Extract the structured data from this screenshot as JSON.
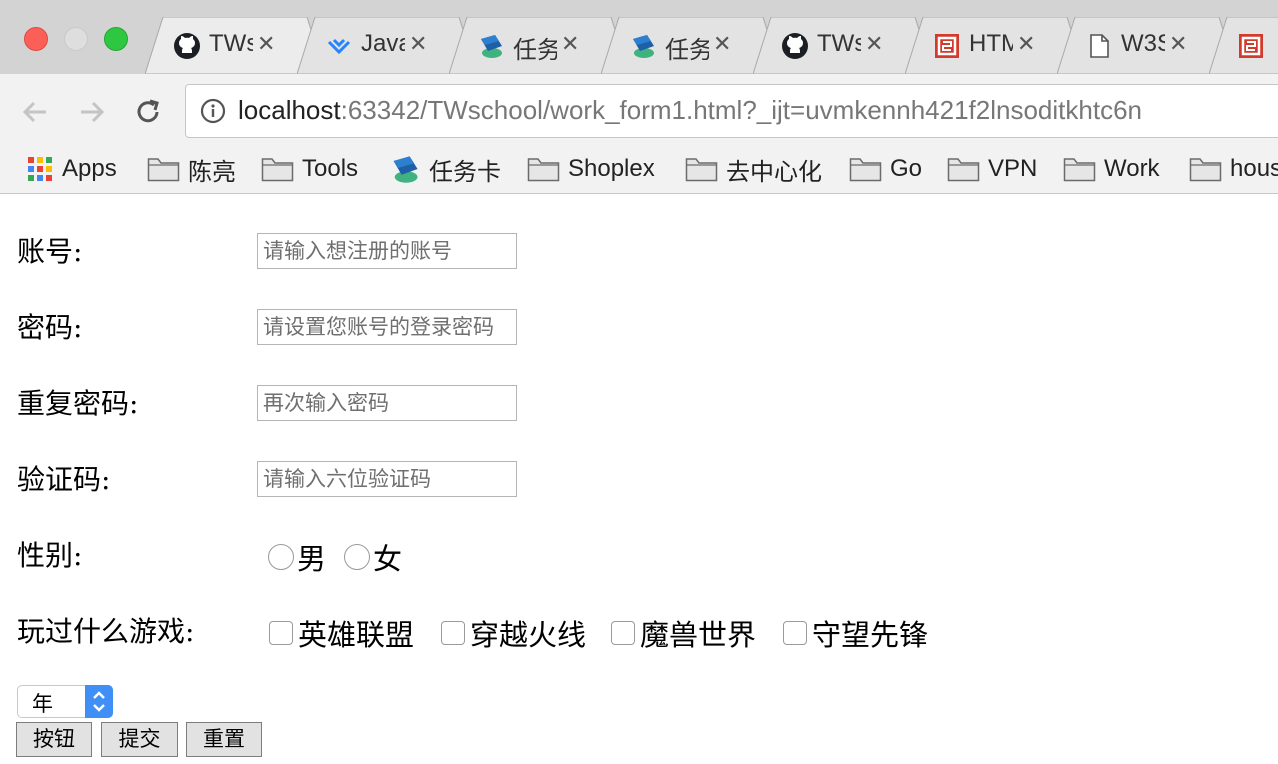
{
  "browser": {
    "tabs": [
      {
        "title": "TWs",
        "icon": "github-icon"
      },
      {
        "title": "Java",
        "icon": "jira-icon"
      },
      {
        "title": "任务",
        "icon": "stack-icon"
      },
      {
        "title": "任务",
        "icon": "stack-icon"
      },
      {
        "title": "TWs",
        "icon": "github-icon"
      },
      {
        "title": "HTM",
        "icon": "html5-icon"
      },
      {
        "title": "W3S",
        "icon": "page-icon"
      },
      {
        "title": "",
        "icon": "html5-icon"
      }
    ],
    "tab_close_glyph": "✕",
    "url_host": "localhost",
    "url_rest": ":63342/TWschool/work_form1.html?_ijt=uvmkennh421f2lnsoditkhtc6n",
    "bookmarks": [
      {
        "label": "Apps",
        "icon": "apps-grid-icon"
      },
      {
        "label": "陈亮",
        "icon": "folder-icon"
      },
      {
        "label": "Tools",
        "icon": "folder-icon"
      },
      {
        "label": "任务卡",
        "icon": "stack-icon"
      },
      {
        "label": "Shoplex",
        "icon": "folder-icon"
      },
      {
        "label": "去中心化",
        "icon": "folder-icon"
      },
      {
        "label": "Go",
        "icon": "folder-icon"
      },
      {
        "label": "VPN",
        "icon": "folder-icon"
      },
      {
        "label": "Work",
        "icon": "folder-icon"
      },
      {
        "label": "hous",
        "icon": "folder-icon"
      }
    ]
  },
  "form": {
    "account": {
      "label": "账号:",
      "placeholder": "请输入想注册的账号",
      "value": ""
    },
    "password": {
      "label": "密码:",
      "placeholder": "请设置您账号的登录密码",
      "value": ""
    },
    "repeat_password": {
      "label": "重复密码:",
      "placeholder": "再次输入密码",
      "value": ""
    },
    "captcha": {
      "label": "验证码:",
      "placeholder": "请输入六位验证码",
      "value": ""
    },
    "gender": {
      "label": "性别:",
      "options": [
        "男",
        "女"
      ],
      "selected": null
    },
    "games": {
      "label": "玩过什么游戏:",
      "options": [
        "英雄联盟",
        "穿越火线",
        "魔兽世界",
        "守望先锋"
      ],
      "checked": []
    },
    "year_select": {
      "value": "年"
    },
    "buttons": {
      "button": "按钮",
      "submit": "提交",
      "reset": "重置"
    }
  },
  "colors": {
    "tab_strip": "#d3d3d3",
    "toolbar": "#f2f2f2",
    "select_accent": "#3f8ff7",
    "traffic_close": "#fc5f57",
    "traffic_max": "#2dc840"
  }
}
